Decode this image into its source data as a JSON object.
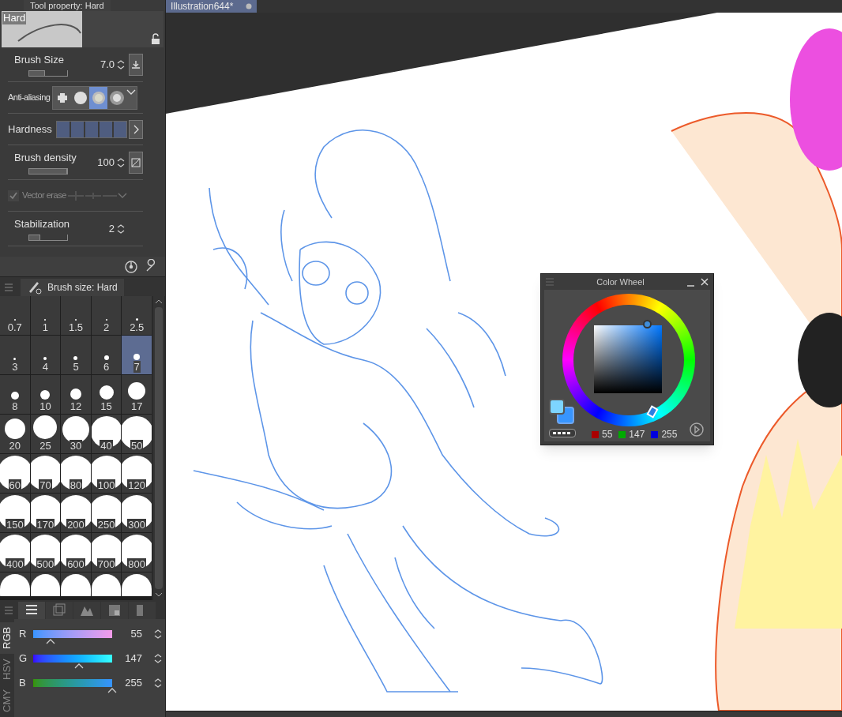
{
  "tool_property": {
    "title": "Tool property: Hard",
    "preview_label": "Hard",
    "rows": [
      {
        "kind": "slider",
        "label": "Brush Size",
        "value": "7.0",
        "level": 0.42,
        "has_button": true
      },
      {
        "kind": "options",
        "label": "Anti-aliasing",
        "options": [
          {
            "selected": false
          },
          {
            "selected": false
          },
          {
            "selected": true
          },
          {
            "selected": false
          }
        ]
      },
      {
        "kind": "segments",
        "label": "Hardness",
        "level": 1
      },
      {
        "kind": "slider",
        "label": "Brush density",
        "value": "100",
        "level": 1,
        "has_button": true
      },
      {
        "kind": "check",
        "label": "Vector erase",
        "checked": true,
        "disabled": true
      },
      {
        "kind": "slider",
        "label": "Stabilization",
        "value": "2",
        "level": 0.3
      }
    ]
  },
  "brush_size": {
    "tab": "Brush size: Hard",
    "sizes": [
      {
        "label": "0.7",
        "selected": false
      },
      {
        "label": "1",
        "selected": false
      },
      {
        "label": "1.5",
        "selected": false
      },
      {
        "label": "2",
        "selected": false
      },
      {
        "label": "2.5",
        "selected": false
      },
      {
        "label": "3",
        "selected": false
      },
      {
        "label": "4",
        "selected": false
      },
      {
        "label": "5",
        "selected": false
      },
      {
        "label": "6",
        "selected": false
      },
      {
        "label": "7",
        "selected": true
      },
      {
        "label": "8",
        "selected": false
      },
      {
        "label": "10",
        "selected": false
      },
      {
        "label": "12",
        "selected": false
      },
      {
        "label": "15",
        "selected": false
      },
      {
        "label": "17",
        "selected": false
      },
      {
        "label": "20",
        "selected": false
      },
      {
        "label": "25",
        "selected": false
      },
      {
        "label": "30",
        "selected": false
      },
      {
        "label": "40",
        "selected": false
      },
      {
        "label": "50",
        "selected": false
      },
      {
        "label": "60",
        "selected": false
      },
      {
        "label": "70",
        "selected": false
      },
      {
        "label": "80",
        "selected": false
      },
      {
        "label": "100",
        "selected": false
      },
      {
        "label": "120",
        "selected": false
      },
      {
        "label": "150",
        "selected": false
      },
      {
        "label": "170",
        "selected": false
      },
      {
        "label": "200",
        "selected": false
      },
      {
        "label": "250",
        "selected": false
      },
      {
        "label": "300",
        "selected": false
      },
      {
        "label": "400",
        "selected": false
      },
      {
        "label": "500",
        "selected": false
      },
      {
        "label": "600",
        "selected": false
      },
      {
        "label": "700",
        "selected": false
      },
      {
        "label": "800",
        "selected": false
      }
    ]
  },
  "color_slider": {
    "modes": [
      {
        "label": "RGB",
        "selected": true
      },
      {
        "label": "HSV",
        "selected": false
      },
      {
        "label": "CMY",
        "selected": false
      }
    ],
    "channels": [
      {
        "label": "R",
        "value": "55",
        "level": 0.22
      },
      {
        "label": "G",
        "value": "147",
        "level": 0.58
      },
      {
        "label": "B",
        "value": "255",
        "level": 1
      }
    ]
  },
  "document_tab": {
    "title": "Illustration644*"
  },
  "color_wheel": {
    "title": "Color Wheel",
    "values": [
      {
        "value": "55",
        "color": "#aa0000"
      },
      {
        "value": "147",
        "color": "#00aa00"
      },
      {
        "value": "255",
        "color": "#0000dd"
      }
    ]
  }
}
